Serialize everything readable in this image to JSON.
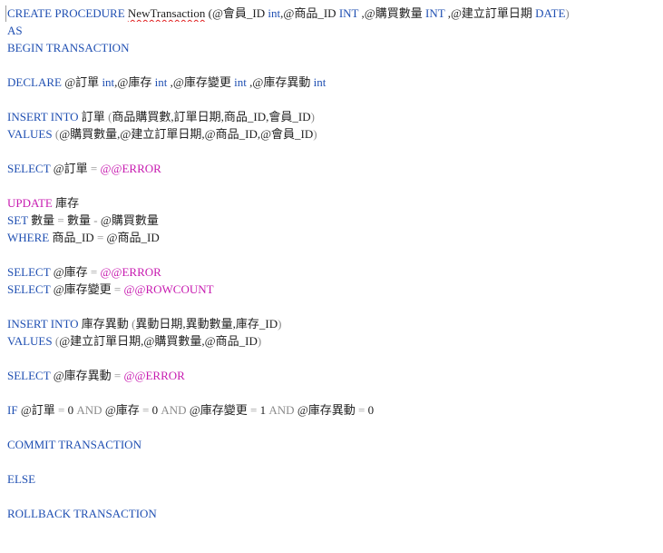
{
  "editor": {
    "lines": [
      [
        {
          "t": "CREATE PROCEDURE ",
          "c": "kw"
        },
        {
          "t": "NewTransaction",
          "c": "ident squiggle"
        },
        {
          "t": " (@會員_ID ",
          "c": "ident"
        },
        {
          "t": "int",
          "c": "kw"
        },
        {
          "t": ",@商品_ID ",
          "c": "ident"
        },
        {
          "t": "INT",
          "c": "kw"
        },
        {
          "t": " ,@購買數量 ",
          "c": "ident"
        },
        {
          "t": "INT",
          "c": "kw"
        },
        {
          "t": " ,@建立訂單日期 ",
          "c": "ident"
        },
        {
          "t": "DATE",
          "c": "kw"
        },
        {
          "t": ")",
          "c": "op"
        }
      ],
      [
        {
          "t": "AS",
          "c": "kw"
        }
      ],
      [
        {
          "t": "BEGIN TRANSACTION",
          "c": "kw"
        }
      ],
      [],
      [
        {
          "t": "DECLARE ",
          "c": "kw"
        },
        {
          "t": "@訂單 ",
          "c": "ident"
        },
        {
          "t": "int",
          "c": "kw"
        },
        {
          "t": ",@庫存 ",
          "c": "ident"
        },
        {
          "t": "int",
          "c": "kw"
        },
        {
          "t": " ,@庫存變更 ",
          "c": "ident"
        },
        {
          "t": "int",
          "c": "kw"
        },
        {
          "t": " ,@庫存異動 ",
          "c": "ident"
        },
        {
          "t": "int",
          "c": "kw"
        }
      ],
      [],
      [
        {
          "t": "INSERT INTO ",
          "c": "kw"
        },
        {
          "t": "訂單 ",
          "c": "ident"
        },
        {
          "t": "(",
          "c": "op"
        },
        {
          "t": "商品購買數,訂單日期,商品_ID,會員_ID",
          "c": "ident"
        },
        {
          "t": ")",
          "c": "op"
        }
      ],
      [
        {
          "t": "VALUES ",
          "c": "kw"
        },
        {
          "t": "(",
          "c": "op"
        },
        {
          "t": "@購買數量,@建立訂單日期,@商品_ID,@會員_ID",
          "c": "ident"
        },
        {
          "t": ")",
          "c": "op"
        }
      ],
      [],
      [
        {
          "t": "SELECT ",
          "c": "kw"
        },
        {
          "t": "@訂單 ",
          "c": "ident"
        },
        {
          "t": "= ",
          "c": "op"
        },
        {
          "t": "@@ERROR",
          "c": "sys"
        }
      ],
      [],
      [
        {
          "t": "UPDATE ",
          "c": "sys"
        },
        {
          "t": "庫存",
          "c": "ident"
        }
      ],
      [
        {
          "t": "SET ",
          "c": "kw"
        },
        {
          "t": "數量 ",
          "c": "ident"
        },
        {
          "t": "= ",
          "c": "op"
        },
        {
          "t": "數量 ",
          "c": "ident"
        },
        {
          "t": "- ",
          "c": "op"
        },
        {
          "t": "@購買數量",
          "c": "ident"
        }
      ],
      [
        {
          "t": "WHERE ",
          "c": "kw"
        },
        {
          "t": "商品_ID ",
          "c": "ident"
        },
        {
          "t": "= ",
          "c": "op"
        },
        {
          "t": "@商品_ID",
          "c": "ident"
        }
      ],
      [],
      [
        {
          "t": "SELECT ",
          "c": "kw"
        },
        {
          "t": "@庫存 ",
          "c": "ident"
        },
        {
          "t": "= ",
          "c": "op"
        },
        {
          "t": "@@ERROR",
          "c": "sys"
        }
      ],
      [
        {
          "t": "SELECT ",
          "c": "kw"
        },
        {
          "t": "@庫存變更 ",
          "c": "ident"
        },
        {
          "t": "= ",
          "c": "op"
        },
        {
          "t": "@@ROWCOUNT",
          "c": "sys"
        }
      ],
      [],
      [
        {
          "t": "INSERT INTO ",
          "c": "kw"
        },
        {
          "t": "庫存異動 ",
          "c": "ident"
        },
        {
          "t": "(",
          "c": "op"
        },
        {
          "t": "異動日期,異動數量,庫存_ID",
          "c": "ident"
        },
        {
          "t": ")",
          "c": "op"
        }
      ],
      [
        {
          "t": "VALUES ",
          "c": "kw"
        },
        {
          "t": "(",
          "c": "op"
        },
        {
          "t": "@建立訂單日期,@購買數量,@商品_ID",
          "c": "ident"
        },
        {
          "t": ")",
          "c": "op"
        }
      ],
      [],
      [
        {
          "t": "SELECT ",
          "c": "kw"
        },
        {
          "t": "@庫存異動 ",
          "c": "ident"
        },
        {
          "t": "= ",
          "c": "op"
        },
        {
          "t": "@@ERROR",
          "c": "sys"
        }
      ],
      [],
      [
        {
          "t": "IF ",
          "c": "kw"
        },
        {
          "t": "@訂單 ",
          "c": "ident"
        },
        {
          "t": "= ",
          "c": "op"
        },
        {
          "t": "0 ",
          "c": "num"
        },
        {
          "t": "AND ",
          "c": "op"
        },
        {
          "t": "@庫存 ",
          "c": "ident"
        },
        {
          "t": "= ",
          "c": "op"
        },
        {
          "t": "0 ",
          "c": "num"
        },
        {
          "t": "AND ",
          "c": "op"
        },
        {
          "t": "@庫存變更 ",
          "c": "ident"
        },
        {
          "t": "= ",
          "c": "op"
        },
        {
          "t": "1 ",
          "c": "num"
        },
        {
          "t": "AND ",
          "c": "op"
        },
        {
          "t": "@庫存異動 ",
          "c": "ident"
        },
        {
          "t": "= ",
          "c": "op"
        },
        {
          "t": "0",
          "c": "num"
        }
      ],
      [],
      [
        {
          "t": "COMMIT TRANSACTION",
          "c": "kw"
        }
      ],
      [],
      [
        {
          "t": "ELSE",
          "c": "kw"
        }
      ],
      [],
      [
        {
          "t": "ROLLBACK TRANSACTION",
          "c": "kw"
        }
      ]
    ]
  }
}
